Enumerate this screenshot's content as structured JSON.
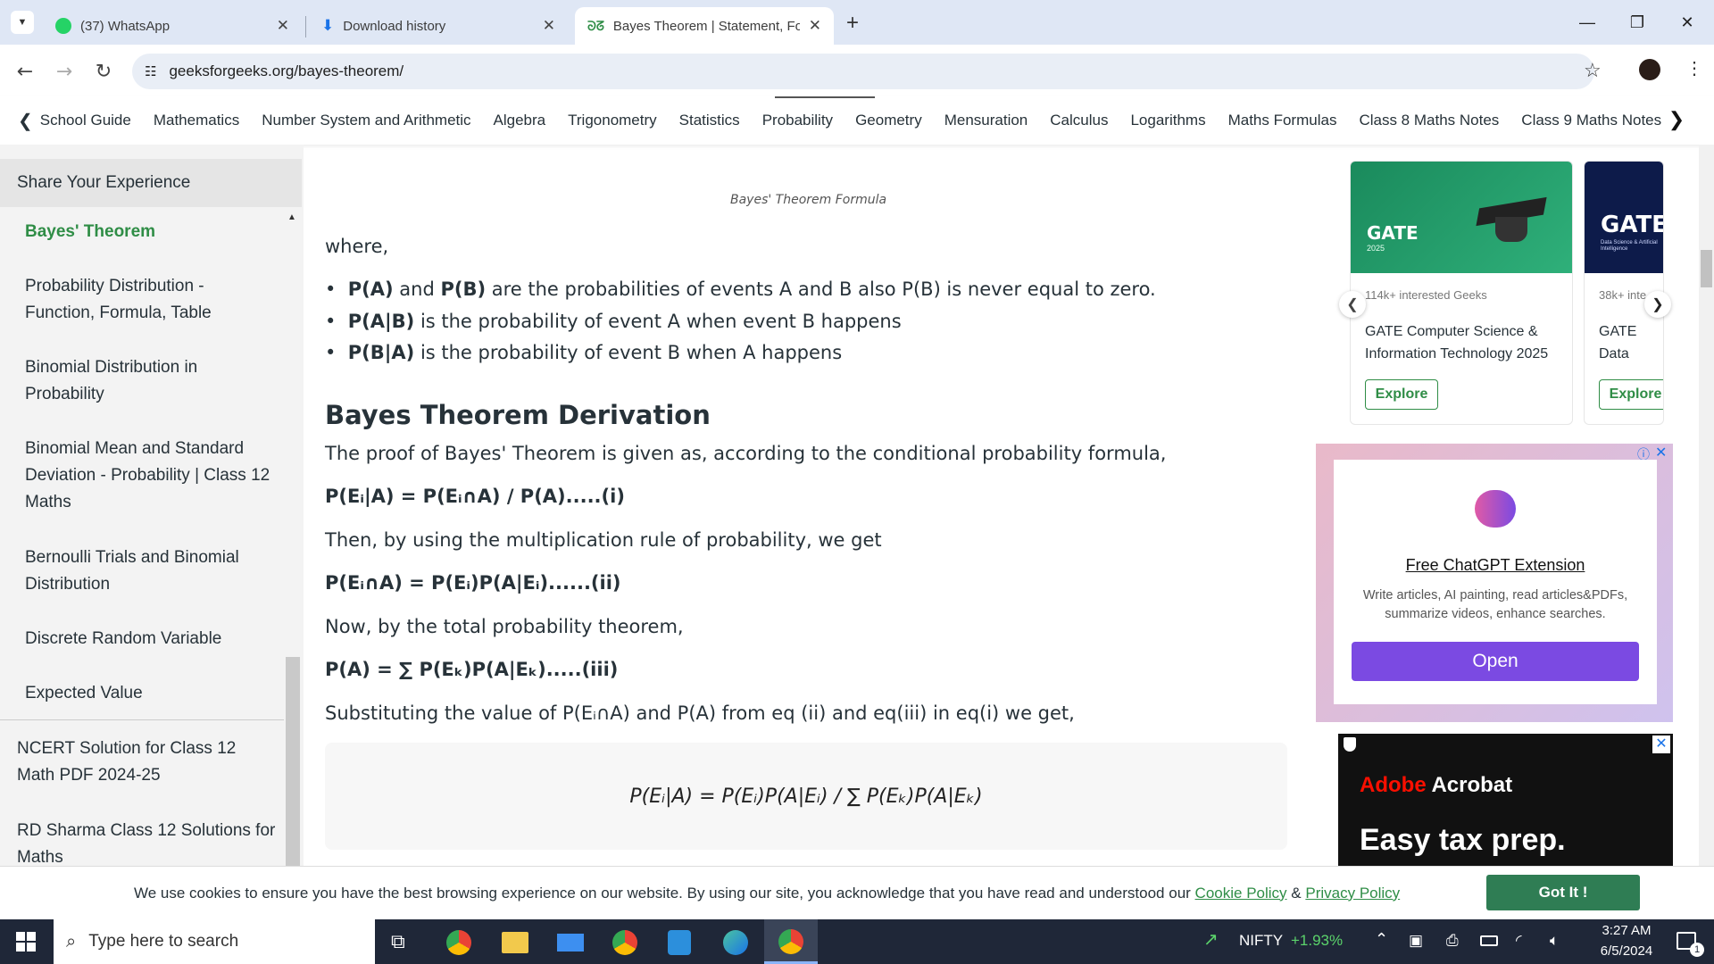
{
  "browser": {
    "tabs": [
      {
        "title": "(37) WhatsApp",
        "icon": "whatsapp-icon"
      },
      {
        "title": "Download history",
        "icon": "download-icon"
      },
      {
        "title": "Bayes Theorem | Statement, For",
        "icon": "gfg-logo-icon"
      }
    ],
    "url": "geeksforgeeks.org/bayes-theorem/"
  },
  "site_nav": {
    "items": [
      "School Guide",
      "Mathematics",
      "Number System and Arithmetic",
      "Algebra",
      "Trigonometry",
      "Statistics",
      "Probability",
      "Geometry",
      "Mensuration",
      "Calculus",
      "Logarithms",
      "Maths Formulas",
      "Class 8 Maths Notes",
      "Class 9 Maths Notes"
    ]
  },
  "sidebar": {
    "share": "Share Your Experience",
    "current": "Bayes' Theorem",
    "items": [
      "Probability Distribution - Function, Formula, Table",
      "Binomial Distribution in Probability",
      "Binomial Mean and Standard Deviation - Probability | Class 12 Maths",
      "Bernoulli Trials and Binomial Distribution",
      "Discrete Random Variable",
      "Expected Value"
    ],
    "section_items": [
      "NCERT Solution for Class 12 Math PDF 2024-25",
      "RD Sharma Class 12 Solutions for Maths"
    ]
  },
  "article": {
    "caption": "Bayes' Theorem Formula",
    "where": "where,",
    "bullets": [
      {
        "bold": "P(A)",
        "mid": " and ",
        "bold2": "P(B)",
        "rest": " are the probabilities of events A and B also P(B) is never equal to zero."
      },
      {
        "bold": "P(A|B)",
        "rest": " is the probability of event A when event B happens"
      },
      {
        "bold": "P(B|A)",
        "rest": " is the probability of event B when A happens"
      }
    ],
    "heading": "Bayes Theorem Derivation",
    "intro": "The proof of Bayes' Theorem is given as, according to the conditional probability formula,",
    "eq1": "P(Eᵢ|A) = P(Eᵢ∩A) / P(A).....(i)",
    "then": "Then, by using the multiplication rule of probability, we get",
    "eq2": "P(Eᵢ∩A) = P(Eᵢ)P(A|Eᵢ)......(ii)",
    "now": "Now, by the total probability theorem,",
    "eq3": "P(A) = ∑ P(Eₖ)P(A|Eₖ).....(iii)",
    "subst": "Substituting the value of P(Eᵢ∩A) and P(A) from eq (ii) and eq(iii) in eq(i) we get,",
    "final": "P(Eᵢ|A) = P(Eᵢ)P(A|Eᵢ) / ∑ P(Eₖ)P(A|Eₖ)"
  },
  "courses": [
    {
      "banner": "GATE",
      "banner_sub": "2025",
      "interest": "114k+ interested Geeks",
      "title": "GATE Computer Science & Information Technology 2025",
      "cta": "Explore"
    },
    {
      "banner": "GATE",
      "banner_sub": "Data Science & Artificial Intelligence",
      "interest": "38k+ inte",
      "title": "GATE Data Science & Artificial I",
      "cta": "Explore"
    }
  ],
  "ad1": {
    "title": "Free ChatGPT Extension",
    "desc": "Write articles, AI painting, read articles&PDFs, summarize videos, enhance searches.",
    "cta": "Open"
  },
  "ad2": {
    "brand": "Adobe",
    "product": "Acrobat",
    "headline": "Easy tax prep."
  },
  "cookie": {
    "text": "We use cookies to ensure you have the best browsing experience on our website. By using our site, you acknowledge that you have read and understood our",
    "link1": "Cookie Policy",
    "amp": "&",
    "link2": "Privacy Policy",
    "button": "Got It !"
  },
  "taskbar": {
    "search": "Type here to search",
    "stock_name": "NIFTY",
    "stock_change": "+1.93%",
    "time": "3:27 AM",
    "date": "6/5/2024",
    "notif": "1"
  },
  "colors": {
    "accent": "#2f8d46",
    "link": "#2f8d46",
    "ad_button": "#7b4ae2",
    "taskbar": "#1f2738"
  }
}
